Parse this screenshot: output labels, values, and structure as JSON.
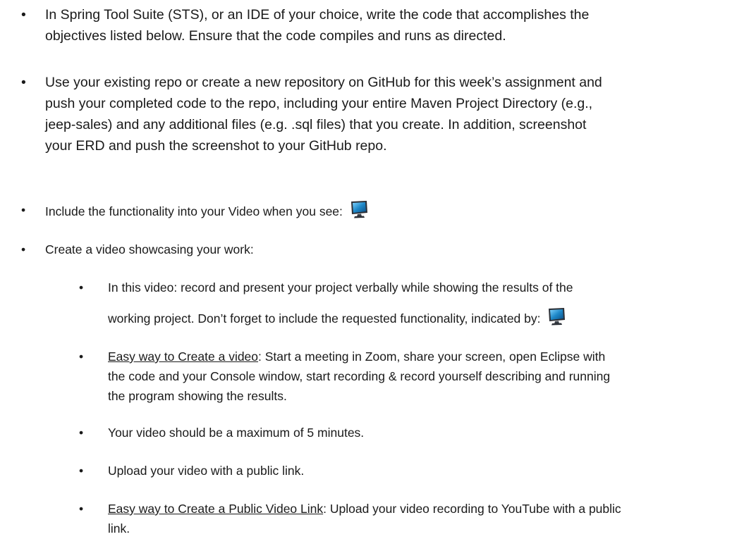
{
  "bullets": {
    "symbol": "•"
  },
  "items": {
    "sts": {
      "line1": "In Spring Tool Suite (STS), or an IDE of your choice, write the code that accomplishes the",
      "line2": "objectives listed below. Ensure that the code compiles and runs as directed."
    },
    "repo": {
      "line1": "Use your existing repo or create a new repository on GitHub for this week’s assignment and",
      "line2": "push your completed code to the repo, including your entire Maven Project Directory (e.g.,",
      "line3": "jeep-sales) and any additional files (e.g. .sql files) that you create.  In addition, screenshot",
      "line4": "your ERD and push the screenshot to your GitHub repo."
    },
    "include": {
      "text": "Include the functionality into your Video when you see:",
      "icon": "monitor-icon"
    },
    "create_video": {
      "text": "Create a video showcasing your work:"
    },
    "sub": {
      "record": {
        "line1": "In this video: record and present your project verbally while showing the results of the",
        "line2": "working project.   Don’t forget to include the requested functionality, indicated by:",
        "icon": "monitor-icon"
      },
      "easy_video": {
        "link": "Easy way to Create a video",
        "line1_rest": ":  Start a meeting in Zoom, share your screen, open Eclipse with",
        "line2": "the code and your Console window, start recording & record yourself describing and running",
        "line3": "the program showing the results."
      },
      "max": {
        "text": "Your video should be a maximum of 5 minutes."
      },
      "upload": {
        "text": "Upload your video with a public link."
      },
      "easy_link": {
        "link": "Easy way to Create a Public Video Link",
        "line1_rest": ":  Upload your video recording to YouTube with a public",
        "line2": "link."
      }
    }
  },
  "colors": {
    "text": "#1a1a1a",
    "icon_screen": "#1e88c8",
    "icon_frame": "#2b2f36"
  }
}
